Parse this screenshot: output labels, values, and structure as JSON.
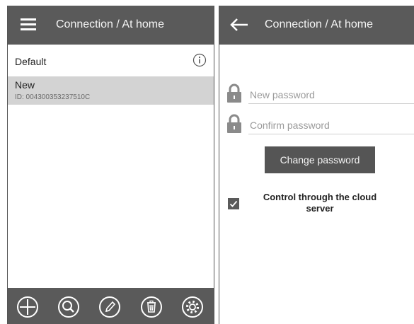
{
  "left_screen": {
    "title": "Connection / At home",
    "items": [
      {
        "name": "Default"
      },
      {
        "name": "New",
        "id_text": "ID: 004300353237510C"
      }
    ],
    "toolbar": [
      "add-icon",
      "search-icon",
      "edit-icon",
      "delete-icon",
      "settings-icon"
    ]
  },
  "right_screen": {
    "title": "Connection / At home",
    "new_password_placeholder": "New password",
    "confirm_password_placeholder": "Confirm password",
    "change_button": "Change password",
    "cloud_label": "Control through the cloud server",
    "cloud_checked": true
  },
  "colors": {
    "bar": "#5a5a5a",
    "selected_row": "#d3d3d3"
  }
}
